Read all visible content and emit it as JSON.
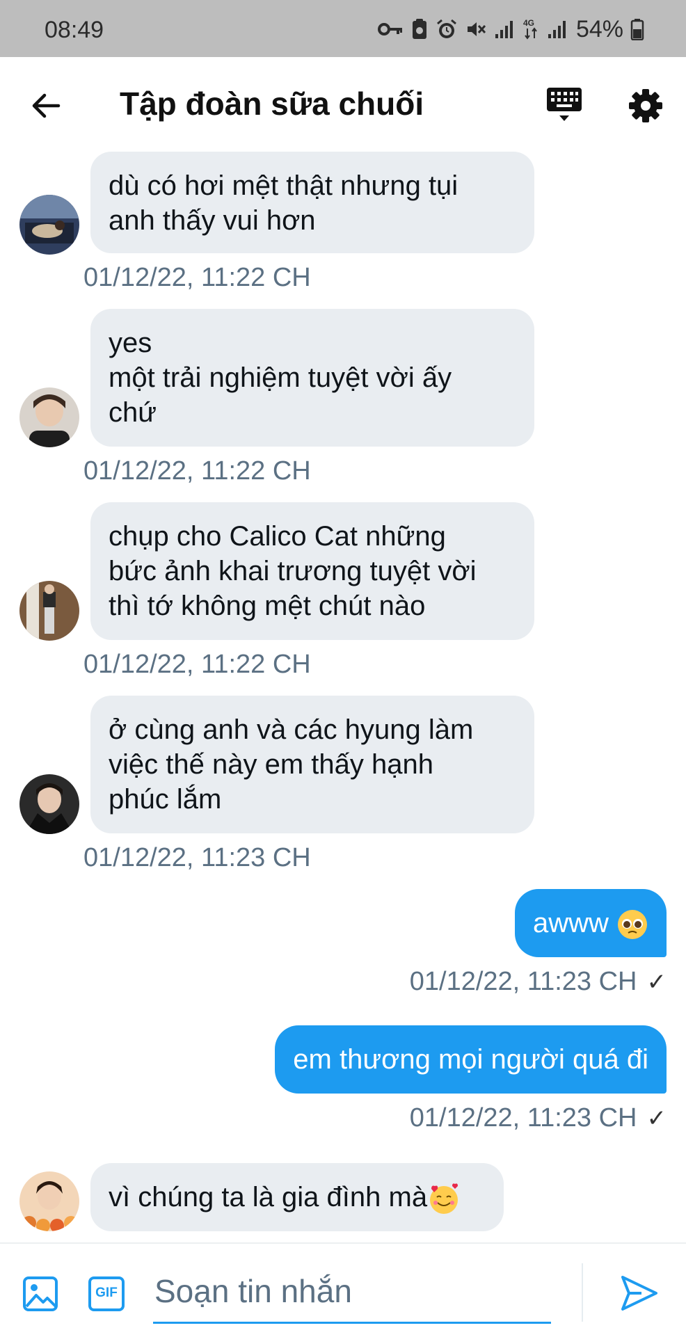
{
  "status_bar": {
    "time": "08:49",
    "battery": "54%"
  },
  "header": {
    "title": "Tập đoàn sữa chuối"
  },
  "messages": [
    {
      "text": "dù có hơi mệt thật nhưng tụi\nanh thấy vui hơn",
      "time": "01/12/22, 11:22 CH"
    },
    {
      "text": "yes\nmột trải nghiệm tuyệt vời ấy\nchứ",
      "time": "01/12/22, 11:22 CH"
    },
    {
      "text": "chụp cho Calico Cat những\nbức ảnh khai trương tuyệt vời\nthì tớ không mệt chút nào",
      "time": "01/12/22, 11:22 CH"
    },
    {
      "text": "ở cùng anh và các hyung làm\nviệc thế này em thấy hạnh\nphúc lắm",
      "time": "01/12/22, 11:23 CH"
    },
    {
      "text": "awww",
      "emoji": "pleading-face",
      "time": "01/12/22, 11:23 CH",
      "outgoing": true
    },
    {
      "text": "em thương mọi người quá đi",
      "time": "01/12/22, 11:23 CH",
      "outgoing": true
    },
    {
      "text": "vì chúng ta là gia đình mà",
      "emoji": "smiling-face-with-hearts"
    }
  ],
  "composer": {
    "placeholder": "Soạn tin nhắn",
    "gif_label": "GIF"
  },
  "colors": {
    "accent": "#1d9bf0",
    "bubble_in": "#e9edf1",
    "timestamp": "#5b7083"
  }
}
